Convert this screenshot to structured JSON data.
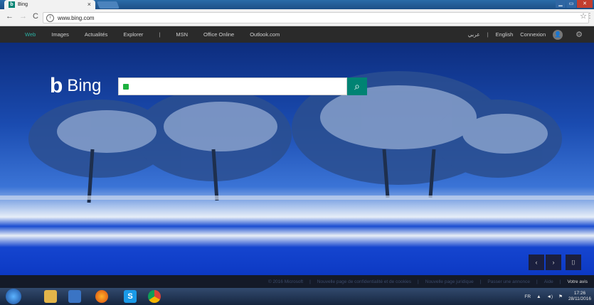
{
  "browser": {
    "tab_title": "Bing",
    "tab_close": "×",
    "back": "←",
    "forward": "→",
    "reload": "C",
    "url": "www.bing.com",
    "info": "i",
    "star": "☆",
    "menu": "⋮",
    "win_min": "▁",
    "win_max": "▭",
    "win_close": "✕"
  },
  "header": {
    "nav": [
      "Web",
      "Images",
      "Actualités",
      "Explorer",
      "MSN",
      "Office Online",
      "Outlook.com"
    ],
    "separator": "|",
    "arabic": "عربي",
    "english": "English",
    "signin": "Connexion",
    "avatar": "👤",
    "gear": "⚙"
  },
  "hero": {
    "logo_mark": "b",
    "logo_text": "Bing",
    "search_placeholder": "",
    "search_button": "⌕",
    "prev": "‹",
    "next": "›",
    "camera": "⌷"
  },
  "footer": {
    "copyright": "© 2016 Microsoft",
    "links": [
      "Nouvelle page de confidentialité et de cookies",
      "Nouvelle page juridique",
      "Passer une annonce",
      "Aide",
      "Votre avis"
    ]
  },
  "taskbar": {
    "lang": "FR",
    "time": "17:26",
    "date": "28/11/2016"
  },
  "colors": {
    "accent": "#008373",
    "nav_active": "#2bb1a3"
  }
}
